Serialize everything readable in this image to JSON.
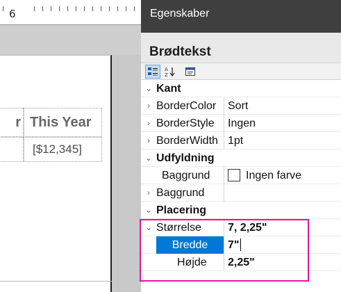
{
  "ruler": {
    "number": "6"
  },
  "report": {
    "header_prev_fragment": "r",
    "header": "This Year",
    "value": "[$12,345]"
  },
  "properties": {
    "pane_title": "Egenskaber",
    "object_name": "Brødtekst",
    "toolbar": {
      "categorized_icon": "categorized-icon",
      "alphabetical_icon": "alphabetical-sort-icon",
      "property_pages_icon": "property-pages-icon"
    },
    "categories": {
      "kant": {
        "label": "Kant",
        "border_color": {
          "name": "BorderColor",
          "value": "Sort"
        },
        "border_style": {
          "name": "BorderStyle",
          "value": "Ingen"
        },
        "border_width": {
          "name": "BorderWidth",
          "value": "1pt"
        }
      },
      "udfyldning": {
        "label": "Udfyldning",
        "background_color": {
          "name": "Baggrund",
          "value": "Ingen farve"
        },
        "background_image": {
          "name": "Baggrund",
          "value": ""
        }
      },
      "placering": {
        "label": "Placering",
        "size": {
          "name": "Størrelse",
          "value": "7, 2,25\""
        },
        "width": {
          "name": "Bredde",
          "value": "7\""
        },
        "height": {
          "name": "Højde",
          "value": "2,25\""
        }
      }
    }
  },
  "colors": {
    "highlight": "#e4149f",
    "selection": "#0078d7",
    "title_bar": "#3f3f40"
  }
}
